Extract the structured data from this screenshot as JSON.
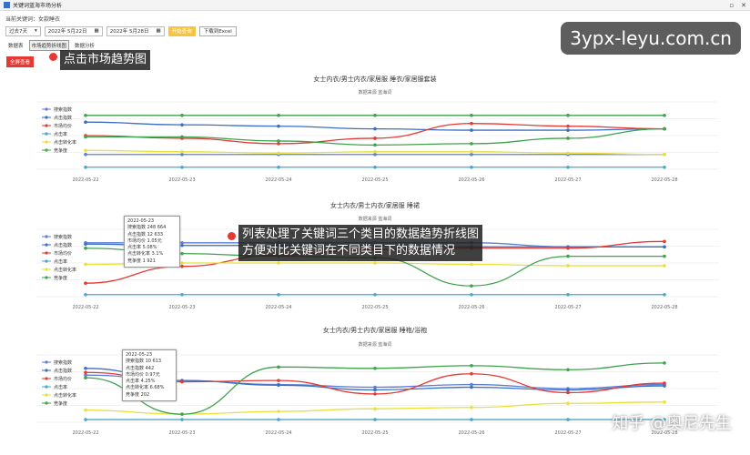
{
  "window": {
    "title": "关键词蓝海市场分析",
    "controls": [
      "▫",
      "✕"
    ]
  },
  "keyword_line": "当前关键词：女款睡衣",
  "toolbar": {
    "range_select": "过去7天",
    "start_date": "2022年 5月22日",
    "end_date": "2022年 5月28日",
    "query_button": "开始查询",
    "export_button": "下载到Excel"
  },
  "tabs": [
    "数据表",
    "市场趋势折线图",
    "数据分析"
  ],
  "all_button": "全屏查看",
  "callouts": {
    "c1": "点击市场趋势图",
    "c2_line1": "列表处理了关键词三个类目的数据趋势折线图",
    "c2_line2": "方便对比关键词在不同类目下的数据情况"
  },
  "watermarks": {
    "site": "3ypx-leyu.com.cn",
    "zhihu": "知乎 @奥尼先生"
  },
  "colors": {
    "search": "#5b7fd6",
    "click": "#3b6fc4",
    "price": "#e53935",
    "ctr": "#4aa7c9",
    "conv": "#e8e13a",
    "comp": "#3fa34d"
  },
  "chart_data": [
    {
      "type": "line",
      "title": "女士内衣/男士内衣/家居服 睡衣/家居服套装",
      "subtitle": "数据来源  蓝海词",
      "x": [
        "2022-05-22",
        "2022-05-23",
        "2022-05-24",
        "2022-05-25",
        "2022-05-26",
        "2022-05-27",
        "2022-05-28"
      ],
      "legend": [
        "搜索指数",
        "点击指数",
        "市场均价",
        "点击率",
        "点击转化率",
        "竞争度"
      ],
      "series": [
        {
          "name": "搜索指数",
          "color": "#5b7fd6",
          "values": [
            0.22,
            0.22,
            0.22,
            0.22,
            0.22,
            0.22,
            0.22
          ]
        },
        {
          "name": "点击指数",
          "color": "#3b6fc4",
          "values": [
            0.7,
            0.66,
            0.64,
            0.6,
            0.58,
            0.58,
            0.6
          ]
        },
        {
          "name": "市场均价",
          "color": "#e53935",
          "values": [
            0.5,
            0.46,
            0.38,
            0.46,
            0.68,
            0.64,
            0.6
          ]
        },
        {
          "name": "点击率",
          "color": "#4aa7c9",
          "values": [
            0.03,
            0.03,
            0.03,
            0.03,
            0.03,
            0.03,
            0.03
          ]
        },
        {
          "name": "点击转化率",
          "color": "#e8e13a",
          "values": [
            0.28,
            0.26,
            0.24,
            0.26,
            0.26,
            0.24,
            0.22
          ]
        },
        {
          "name": "竞争度",
          "color": "#3fa34d",
          "values": [
            0.8,
            0.8,
            0.8,
            0.8,
            0.8,
            0.8,
            0.8
          ]
        }
      ],
      "series2": {
        "name": "竞争度2",
        "color": "#3fa34d",
        "values": [
          0.48,
          0.48,
          0.42,
          0.36,
          0.38,
          0.46,
          0.6
        ]
      }
    },
    {
      "type": "line",
      "title": "女士内衣/男士内衣/家居服 睡裙",
      "subtitle": "数据来源  蓝海词",
      "x": [
        "2022-05-22",
        "2022-05-23",
        "2022-05-24",
        "2022-05-25",
        "2022-05-26",
        "2022-05-27",
        "2022-05-28"
      ],
      "legend": [
        "搜索指数",
        "点击指数",
        "市场均价",
        "点击率",
        "点击转化率",
        "竞争度"
      ],
      "tooltip": {
        "date": "2022-05-23",
        "rows": [
          "搜索指数  248 664",
          "点击指数  12 633",
          "市场均价  1.05元",
          "点击率  5.08%",
          "点击转化率  3.1%",
          "竞争度  1 921"
        ]
      },
      "series": [
        {
          "name": "搜索指数",
          "color": "#5b7fd6",
          "values": [
            0.8,
            0.8,
            0.8,
            0.8,
            0.8,
            0.74,
            0.74
          ]
        },
        {
          "name": "点击指数",
          "color": "#3b6fc4",
          "values": [
            0.78,
            0.76,
            0.76,
            0.76,
            0.74,
            0.74,
            0.74
          ]
        },
        {
          "name": "市场均价",
          "color": "#e53935",
          "values": [
            0.2,
            0.45,
            0.62,
            0.7,
            0.72,
            0.72,
            0.82
          ]
        },
        {
          "name": "点击率",
          "color": "#4aa7c9",
          "values": [
            0.03,
            0.03,
            0.03,
            0.03,
            0.03,
            0.03,
            0.03
          ]
        },
        {
          "name": "点击转化率",
          "color": "#e8e13a",
          "values": [
            0.48,
            0.5,
            0.5,
            0.5,
            0.48,
            0.46,
            0.46
          ]
        },
        {
          "name": "竞争度",
          "color": "#3fa34d",
          "values": [
            0.72,
            0.64,
            0.6,
            0.58,
            0.16,
            0.6,
            0.6
          ]
        }
      ]
    },
    {
      "type": "line",
      "title": "女士内衣/男士内衣/家居服 睡袍/浴袍",
      "subtitle": "数据来源  蓝海词",
      "x": [
        "2022-05-22",
        "2022-05-23",
        "2022-05-24",
        "2022-05-25",
        "2022-05-26",
        "2022-05-27",
        "2022-05-28"
      ],
      "legend": [
        "搜索指数",
        "点击指数",
        "市场均价",
        "点击率",
        "点击转化率",
        "竞争度"
      ],
      "tooltip": {
        "date": "2022-05-23",
        "rows": [
          "搜索指数  10 613",
          "点击指数  442",
          "市场均价  0.97元",
          "点击率  4.25%",
          "点击转化率  6.68%",
          "竞争度  202"
        ]
      },
      "series": [
        {
          "name": "搜索指数",
          "color": "#5b7fd6",
          "values": [
            0.7,
            0.62,
            0.56,
            0.52,
            0.56,
            0.5,
            0.56
          ]
        },
        {
          "name": "点击指数",
          "color": "#3b6fc4",
          "values": [
            0.8,
            0.62,
            0.55,
            0.48,
            0.52,
            0.48,
            0.54
          ]
        },
        {
          "name": "市场均价",
          "color": "#e53935",
          "values": [
            0.74,
            0.6,
            0.62,
            0.42,
            0.72,
            0.44,
            0.58
          ]
        },
        {
          "name": "点击率",
          "color": "#4aa7c9",
          "values": [
            0.04,
            0.04,
            0.04,
            0.04,
            0.04,
            0.04,
            0.04
          ]
        },
        {
          "name": "点击转化率",
          "color": "#e8e13a",
          "values": [
            0.18,
            0.12,
            0.16,
            0.2,
            0.22,
            0.28,
            0.3
          ]
        },
        {
          "name": "竞争度",
          "color": "#3fa34d",
          "values": [
            0.66,
            0.12,
            0.82,
            0.8,
            0.84,
            0.78,
            0.88
          ]
        }
      ]
    }
  ]
}
